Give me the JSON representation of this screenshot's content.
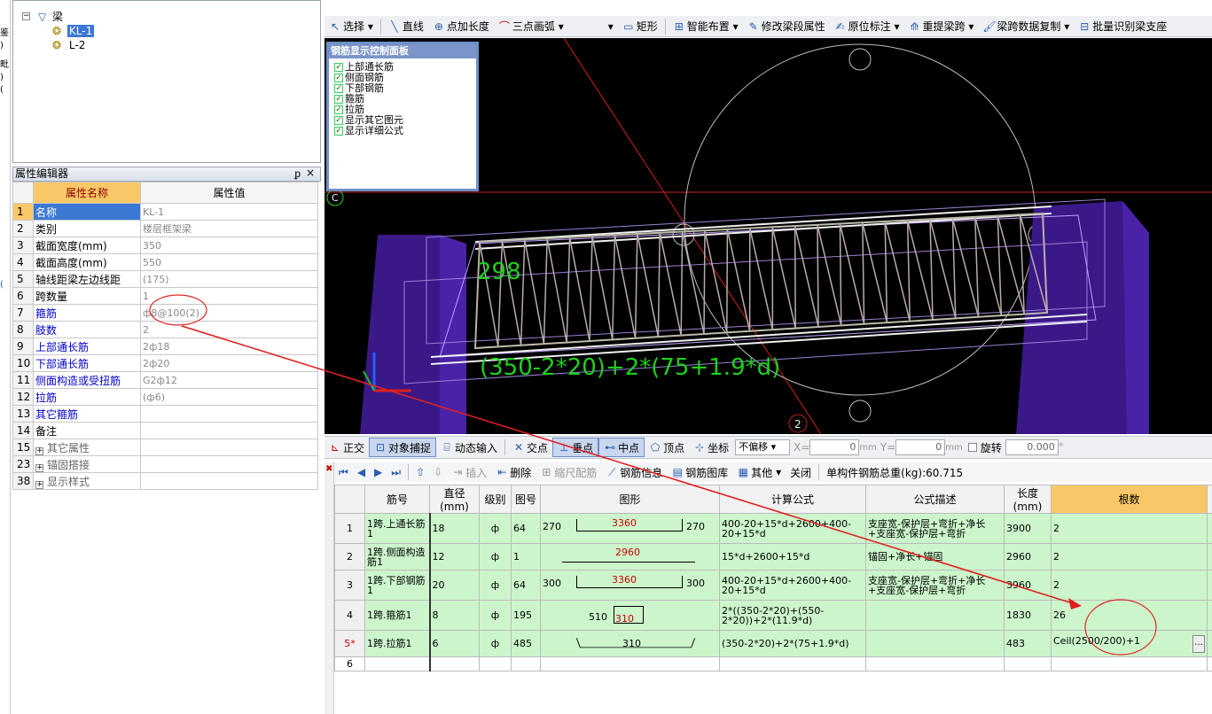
{
  "left_edge": {
    "chars": [
      "鉴",
      ")",
      "毗",
      ")",
      "(",
      "(",
      "("
    ]
  },
  "tree": {
    "root_label": "梁",
    "items": [
      {
        "label": "KL-1",
        "selected": true
      },
      {
        "label": "L-2",
        "selected": false
      }
    ]
  },
  "prop_editor": {
    "title": "属性编辑器",
    "pin": "ᵱ",
    "close": "×",
    "col_name": "属性名称",
    "col_value": "属性值",
    "rows": [
      {
        "n": "1",
        "name": "名称",
        "value": "KL-1"
      },
      {
        "n": "2",
        "name": "类别",
        "value": "楼层框架梁"
      },
      {
        "n": "3",
        "name": "截面宽度(mm)",
        "value": "350"
      },
      {
        "n": "4",
        "name": "截面高度(mm)",
        "value": "550"
      },
      {
        "n": "5",
        "name": "轴线距梁左边线距",
        "value": "(175)"
      },
      {
        "n": "6",
        "name": "跨数量",
        "value": "1"
      },
      {
        "n": "7",
        "name": "箍筋",
        "value": "ф8@100(2)"
      },
      {
        "n": "8",
        "name": "肢数",
        "value": "2"
      },
      {
        "n": "9",
        "name": "上部通长筋",
        "value": "2ф18"
      },
      {
        "n": "10",
        "name": "下部通长筋",
        "value": "2ф20"
      },
      {
        "n": "11",
        "name": "侧面构造或受扭筋",
        "value": "G2ф12"
      },
      {
        "n": "12",
        "name": "拉筋",
        "value": "(ф6)"
      },
      {
        "n": "13",
        "name": "其它箍筋",
        "value": ""
      },
      {
        "n": "14",
        "name": "备注",
        "value": ""
      },
      {
        "n": "15",
        "name": "其它属性",
        "value": ""
      },
      {
        "n": "23",
        "name": "锚固搭接",
        "value": ""
      },
      {
        "n": "38",
        "name": "显示样式",
        "value": ""
      }
    ]
  },
  "toolbar": {
    "select": "选择",
    "line": "直线",
    "point_len": "点加长度",
    "arc3": "三点画弧",
    "rect": "矩形",
    "smart": "智能布置",
    "modify_span": "修改梁段属性",
    "in_place": "原位标注",
    "re_extract": "重提梁跨",
    "copy_span": "梁跨数据复制",
    "batch_identify": "批量识别梁支座"
  },
  "control_panel": {
    "title": "钢筋显示控制面板",
    "items": [
      "上部通长筋",
      "侧面钢筋",
      "下部钢筋",
      "箍筋",
      "拉筋",
      "显示其它图元",
      "显示详细公式"
    ]
  },
  "viewport": {
    "label_298": "298",
    "formula": "(350-2*20)+2*(75+1.9*d)",
    "axis_c": "C",
    "axis_2": "2"
  },
  "snapbar": {
    "ortho": "正交",
    "snap": "对象捕捉",
    "dyn": "动态输入",
    "intersect": "交点",
    "perp": "垂点",
    "mid": "中点",
    "vertex": "顶点",
    "coord": "坐标",
    "offset_mode": "不偏移",
    "x_label": "X=",
    "x_val": "0",
    "mm1": "mm",
    "y_label": "Y=",
    "y_val": "0",
    "mm2": "mm",
    "rotate": "旋转",
    "rotate_val": "0.000",
    "deg": "°"
  },
  "rebarbar": {
    "insert": "插入",
    "delete": "删除",
    "scale": "缩尺配筋",
    "rebar_info": "钢筋信息",
    "rebar_lib": "钢筋图库",
    "other": "其他",
    "close": "关闭",
    "total_label": "单构件钢筋总重(kg):60.715"
  },
  "grid": {
    "headers": [
      "筋号",
      "直径(mm)",
      "级别",
      "图号",
      "图形",
      "计算公式",
      "公式描述",
      "长度(mm)",
      "根数"
    ],
    "rows": [
      {
        "n": "1",
        "name": "1跨.上通长筋1",
        "dia": "18",
        "grade": "ф",
        "fig": "64",
        "shape_l": "270",
        "shape_m": "3360",
        "shape_r": "270",
        "formula": "400-20+15*d+2600+400-20+15*d",
        "desc": "支座宽-保护层+弯折+净长+支座宽-保护层+弯折",
        "len": "3900",
        "count": "2"
      },
      {
        "n": "2",
        "name": "1跨.侧面构造筋1",
        "dia": "12",
        "grade": "ф",
        "fig": "1",
        "shape_l": "",
        "shape_m": "2960",
        "shape_r": "",
        "formula": "15*d+2600+15*d",
        "desc": "锚固+净长+锚固",
        "len": "2960",
        "count": "2"
      },
      {
        "n": "3",
        "name": "1跨.下部钢筋1",
        "dia": "20",
        "grade": "ф",
        "fig": "64",
        "shape_l": "300",
        "shape_m": "3360",
        "shape_r": "300",
        "formula": "400-20+15*d+2600+400-20+15*d",
        "desc": "支座宽-保护层+弯折+净长+支座宽-保护层+弯折",
        "len": "3960",
        "count": "2"
      },
      {
        "n": "4",
        "name": "1跨.箍筋1",
        "dia": "8",
        "grade": "ф",
        "fig": "195",
        "shape_l": "510",
        "shape_m": "310",
        "shape_r": "",
        "formula": "2*((350-2*20)+(550-2*20))+2*(11.9*d)",
        "desc": "",
        "len": "1830",
        "count": "26"
      },
      {
        "n": "5*",
        "name": "1跨.拉筋1",
        "dia": "6",
        "grade": "ф",
        "fig": "485",
        "shape_l": "",
        "shape_m": "310",
        "shape_r": "",
        "formula": "(350-2*20)+2*(75+1.9*d)",
        "desc": "",
        "len": "483",
        "count": "Ceil(2500/200)+1"
      },
      {
        "n": "6",
        "name": "",
        "dia": "",
        "grade": "",
        "fig": "",
        "shape_l": "",
        "shape_m": "",
        "shape_r": "",
        "formula": "",
        "desc": "",
        "len": "",
        "count": ""
      }
    ]
  },
  "colors": {
    "accent": "#f8c868",
    "grid_fill": "#ccf5cc",
    "select_blue": "#3b78d4",
    "annotation_red": "#e02020"
  }
}
